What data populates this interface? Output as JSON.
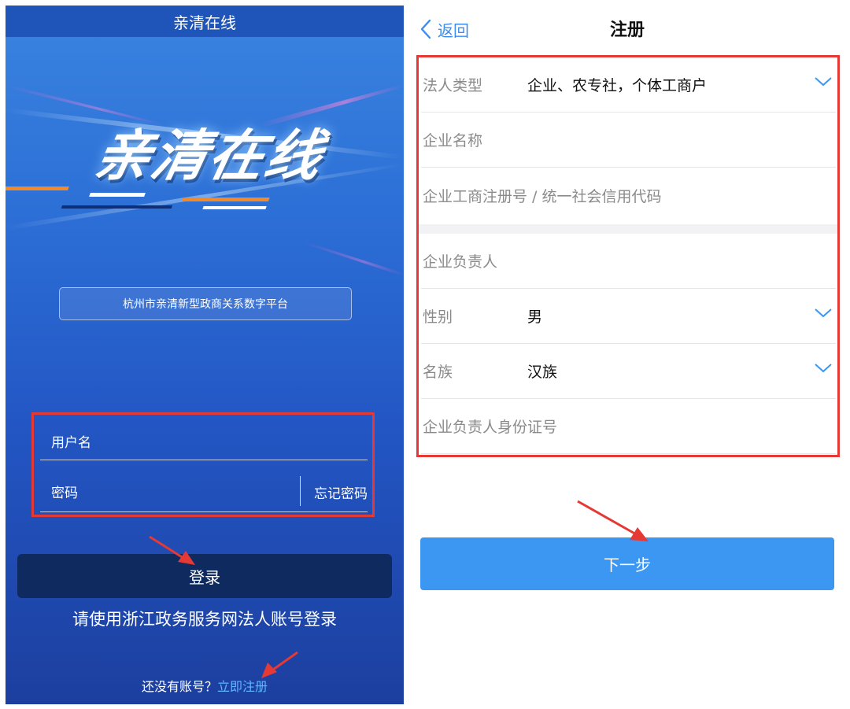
{
  "login": {
    "window_title": "亲清在线",
    "logo_text": "亲清在线",
    "platform_name": "杭州市亲清新型政商关系数字平台",
    "username_placeholder": "用户名",
    "password_placeholder": "密码",
    "forgot_password": "忘记密码",
    "login_button": "登录",
    "hint": "请使用浙江政务服务网法人账号登录",
    "no_account": "还没有账号？",
    "register_now": "立即注册"
  },
  "register": {
    "back_label": "返回",
    "title": "注册",
    "fields": [
      {
        "label": "法人类型",
        "value": "企业、农专社，个体工商户",
        "dropdown": true
      },
      {
        "label": "企业名称"
      },
      {
        "label": "企业工商注册号 / 统一社会信用代码"
      },
      {
        "label": "企业负责人"
      },
      {
        "label": "性别",
        "value": "男",
        "dropdown": true
      },
      {
        "label": "名族",
        "value": "汉族",
        "dropdown": true
      },
      {
        "label": "企业负责人身份证号"
      }
    ],
    "next_button": "下一步"
  },
  "colors": {
    "login_bg": "#2c6fd6",
    "login_button": "#0f2a5e",
    "register_link": "#5fb6ff",
    "primary_blue": "#3b97f1",
    "highlight_red": "#e53935"
  },
  "icons": [
    "chevron-left-icon",
    "chevron-down-icon",
    "red-arrow-annotation"
  ]
}
